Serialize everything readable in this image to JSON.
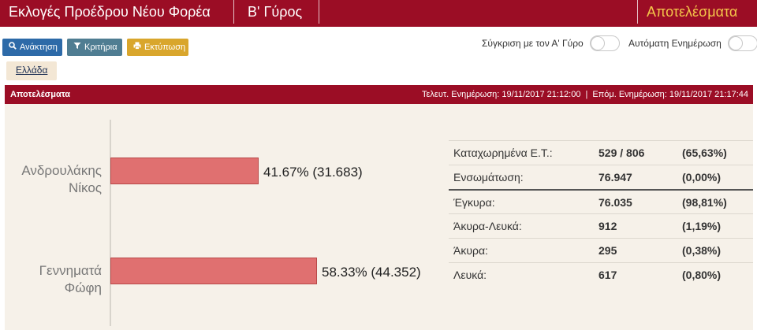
{
  "header": {
    "app_title": "Εκλογές Προέδρου Νέου Φορέα",
    "round": "Β' Γύρος",
    "results_link": "Αποτελέσματα"
  },
  "toolbar": {
    "search_label": "Ανάκτηση",
    "filter_label": "Κριτήρια",
    "print_label": "Εκτύπωση",
    "compare_label": "Σύγκριση με τον Α' Γύρο",
    "compare_on": false,
    "auto_update_label": "Αυτόματη Ενημέρωση",
    "auto_update_on": false
  },
  "breadcrumb": {
    "item": "Ελλάδα"
  },
  "results_bar": {
    "title": "Αποτελέσματα",
    "last_update": "Τελευτ. Ενημέρωση: 19/11/2017 21:12:00",
    "separator": "|",
    "next_update": "Επόμ. Ενημέρωση: 19/11/2017 21:17:44"
  },
  "chart_data": {
    "type": "bar",
    "orientation": "horizontal",
    "categories": [
      "Ανδρουλάκης Νίκος",
      "Γεννηματά Φώφη"
    ],
    "category_lines": [
      [
        "Ανδρουλάκης",
        "Νίκος"
      ],
      [
        "Γεννηματά",
        "Φώφη"
      ]
    ],
    "values": [
      41.67,
      58.33
    ],
    "data_labels": [
      "41.67% (31.683)",
      "58.33% (44.352)"
    ],
    "bar_color": "#e07070"
  },
  "stats": [
    {
      "label": "Καταχωρημένα Ε.Τ.:",
      "value": "529 / 806",
      "pct": "(65,63%)",
      "strong": false
    },
    {
      "label": "Ενσωμάτωση:",
      "value": "76.947",
      "pct": "(0,00%)",
      "strong": false
    },
    {
      "label": "Έγκυρα:",
      "value": "76.035",
      "pct": "(98,81%)",
      "strong": true
    },
    {
      "label": "Άκυρα-Λευκά:",
      "value": "912",
      "pct": "(1,19%)",
      "strong": false
    },
    {
      "label": "Άκυρα:",
      "value": "295",
      "pct": "(0,38%)",
      "strong": false
    },
    {
      "label": "Λευκά:",
      "value": "617",
      "pct": "(0,80%)",
      "strong": false
    }
  ],
  "colors": {
    "brand": "#9b0d25",
    "accent_results": "#f4c64a",
    "search_button": "#2d6aa8",
    "filter_button": "#4f7d92",
    "print_button": "#d9a62c",
    "panel_bg": "#f6f1e9"
  },
  "icons": {
    "search": "search-icon",
    "filter": "filter-icon",
    "print": "print-icon"
  }
}
